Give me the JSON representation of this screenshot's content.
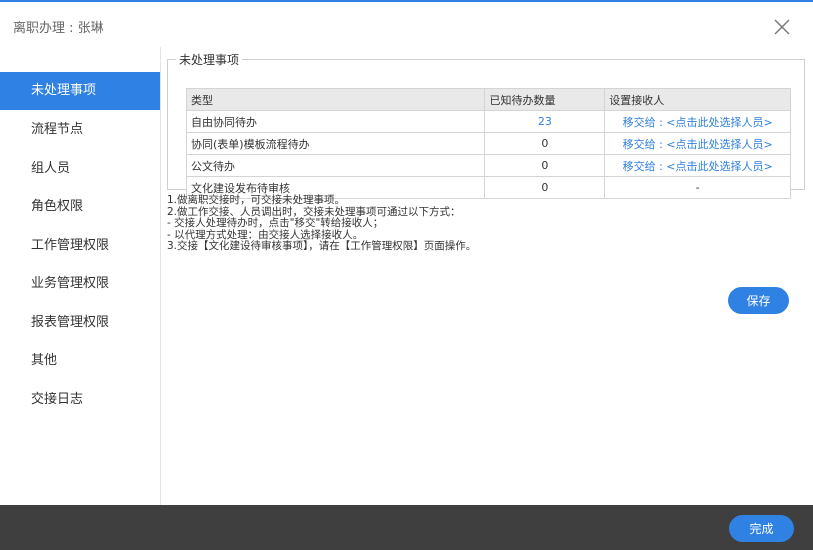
{
  "window": {
    "title": "离职办理 : 张琳"
  },
  "sidebar": {
    "items": [
      {
        "label": "未处理事项",
        "active": true
      },
      {
        "label": "流程节点"
      },
      {
        "label": "组人员"
      },
      {
        "label": "角色权限"
      },
      {
        "label": "工作管理权限"
      },
      {
        "label": "业务管理权限"
      },
      {
        "label": "报表管理权限"
      },
      {
        "label": "其他"
      },
      {
        "label": "交接日志"
      }
    ]
  },
  "pending": {
    "legend": "未处理事项",
    "columns": [
      "类型",
      "已知待办数量",
      "设置接收人"
    ],
    "rows": [
      {
        "type": "自由协同待办",
        "count": "23",
        "action": "移交给 : <点击此处选择人员>"
      },
      {
        "type": "协同(表单)模板流程待办",
        "count": "0",
        "action": "移交给 : <点击此处选择人员>"
      },
      {
        "type": "公文待办",
        "count": "0",
        "action": "移交给 : <点击此处选择人员>"
      },
      {
        "type": "文化建设发布待审核",
        "count": "0",
        "action": "-"
      }
    ]
  },
  "notes": [
    "1.做离职交接时，可交接未处理事项。",
    "2.做工作交接、人员调出时，交接未处理事项可通过以下方式：",
    " - 交接人处理待办时，点击\"移交\"转给接收人；",
    " - 以代理方式处理：由交接人选择接收人。",
    "3.交接【文化建设待审核事项】，请在【工作管理权限】页面操作。"
  ],
  "buttons": {
    "save": "保存",
    "done": "完成"
  },
  "colors": {
    "accent": "#2f82e4",
    "footer": "#3f3f3f"
  }
}
